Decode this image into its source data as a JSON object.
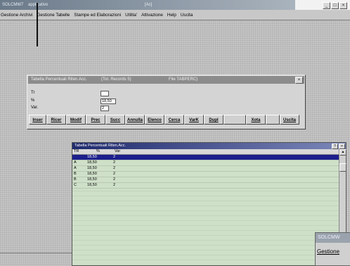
{
  "app": {
    "title_left": "SOLCMW7",
    "title_middle": "applicativo",
    "title_right": "[Ac]",
    "min_label": "_",
    "max_label": "□",
    "close_label": "×"
  },
  "menu": [
    "Gestione Archivi",
    "Gestione Tabelle",
    "Stampe ed Elaborazioni",
    "Utilita'",
    "Attivazione",
    "Help",
    "Uscita"
  ],
  "dialog": {
    "title": "Tabella Percentuali Riten.Acc.",
    "records": "(Tot. Records 5)",
    "file": "File TABPERC)",
    "close_label": "×",
    "fields": [
      {
        "label": "Tr",
        "value": ""
      },
      {
        "label": "%",
        "value": "18,50"
      },
      {
        "label": "Var.",
        "value": "2"
      }
    ],
    "buttons": [
      "Inser",
      "Ricer",
      "Modif",
      "Prec",
      "Succ",
      "Annulla",
      "Elenco",
      "Cerca",
      "VarK",
      "Dupl",
      "",
      "Xota",
      "",
      "Uscita"
    ]
  },
  "table_window": {
    "title": "Tabella Percentuali Riten.Acc.",
    "help_label": "?",
    "close_label": "×",
    "columns": [
      "TR",
      "%",
      "Var"
    ],
    "rows": [
      {
        "tr": "",
        "pct": "18,50",
        "var": "2"
      },
      {
        "tr": "A",
        "pct": "18,50",
        "var": "2"
      },
      {
        "tr": "A",
        "pct": "18,50",
        "var": "2"
      },
      {
        "tr": "B",
        "pct": "18,50",
        "var": "2"
      },
      {
        "tr": "B",
        "pct": "18,50",
        "var": "2"
      },
      {
        "tr": "C",
        "pct": "18,50",
        "var": "2"
      }
    ],
    "scroll_up": "▲",
    "scroll_down": "▼"
  },
  "thumbnail": {
    "title": "SOLCMW",
    "menu": "Gestione"
  }
}
